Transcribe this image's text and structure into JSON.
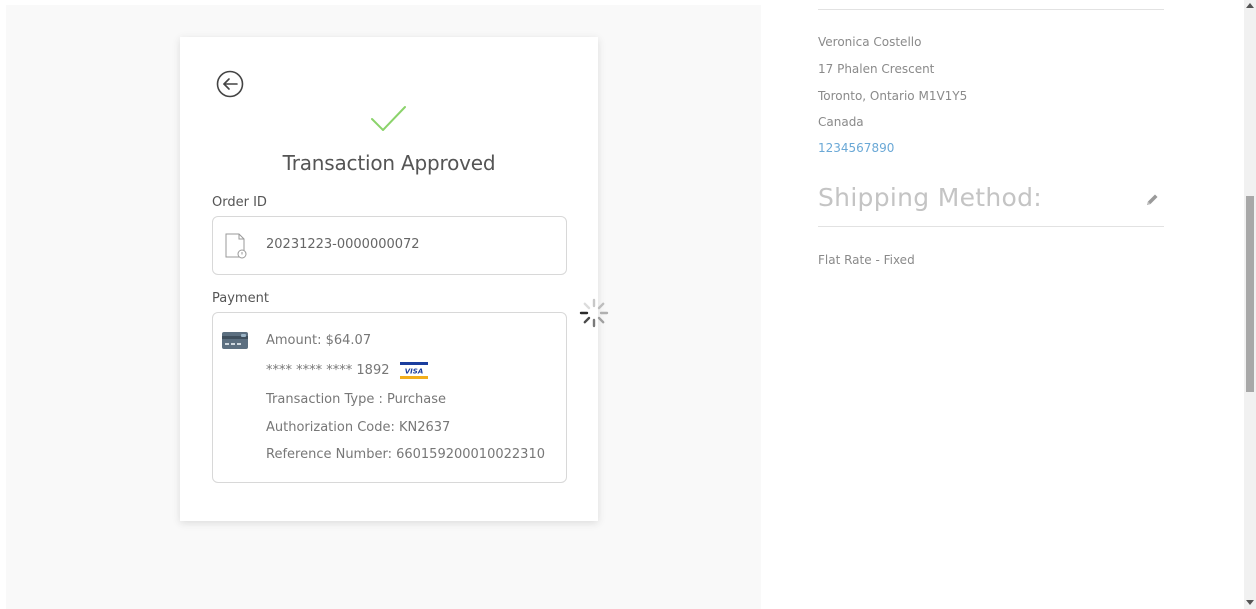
{
  "receipt": {
    "title": "Transaction Approved",
    "order_label": "Order ID",
    "order_id": "20231223-0000000072",
    "payment_label": "Payment",
    "amount": "Amount: $64.07",
    "card_number": "**** **** **** 1892",
    "card_brand": "VISA",
    "transaction_type": "Transaction Type : Purchase",
    "authorization_code": "Authorization Code: KN2637",
    "reference_number": "Reference Number: 660159200010022310",
    "icons": {
      "back": "back-arrow-circle-icon",
      "status": "checkmark-icon",
      "order": "document-icon",
      "payment": "credit-card-icon",
      "brand": "visa-logo"
    },
    "colors": {
      "check": "#8bd36b",
      "visa_blue": "#1a3d9e",
      "visa_gold": "#f2ae1c"
    }
  },
  "loading": {
    "icon": "loading-spinner-icon"
  },
  "shipping_address": {
    "name": "Veronica Costello",
    "street": "17 Phalen Crescent",
    "city_line": "Toronto, Ontario M1V1Y5",
    "country": "Canada",
    "phone": "1234567890",
    "phone_color": "#6aa8d6"
  },
  "shipping_method": {
    "heading": "Shipping Method:",
    "value": "Flat Rate - Fixed",
    "edit_icon": "pencil-icon"
  }
}
